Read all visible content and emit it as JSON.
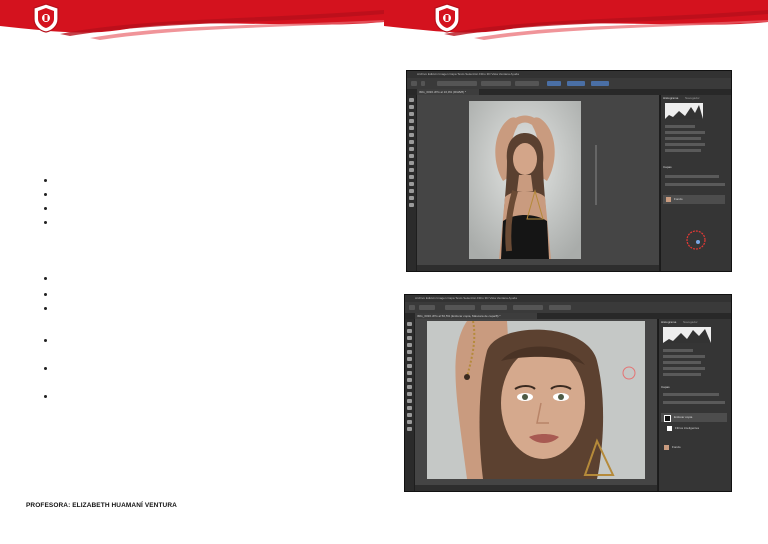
{
  "footer": {
    "teacher": "PROFESORA: ELIZABETH HUAMANÍ VENTURA"
  },
  "colors": {
    "header_red": "#d4121e",
    "photoshop_dark": "#2b2b2b",
    "canvas_gray": "#454545",
    "panel_gray": "#353535",
    "highlight_circle": "#e53935"
  },
  "slide_left": {
    "bullet_groups": [
      4,
      6
    ]
  },
  "screenshot1": {
    "menu": "Archivo  Edición  Imagen  Capa  Texto  Selección  Filtro  3D  Vista  Ventana  Ayuda",
    "tab": "IMG_6036.JPG al 16,9% (RGB/8) *",
    "panel_tabs": [
      "Histograma",
      "Navegador"
    ],
    "layers_header": "Capas",
    "layer_name": "Fondo"
  },
  "screenshot2": {
    "menu": "Archivo  Edición  Imagen  Capa  Texto  Selección  Filtro  3D  Vista  Ventana  Ayuda",
    "tab": "IMG_6036.JPG al 50,5% (Enfocar copia, Máscara de capa/8) *",
    "panel_tabs": [
      "Histograma",
      "Navegador"
    ],
    "layers_header": "Capas",
    "layer_names": [
      "Enfocar copia",
      "Filtros inteligentes",
      "Fondo"
    ]
  }
}
